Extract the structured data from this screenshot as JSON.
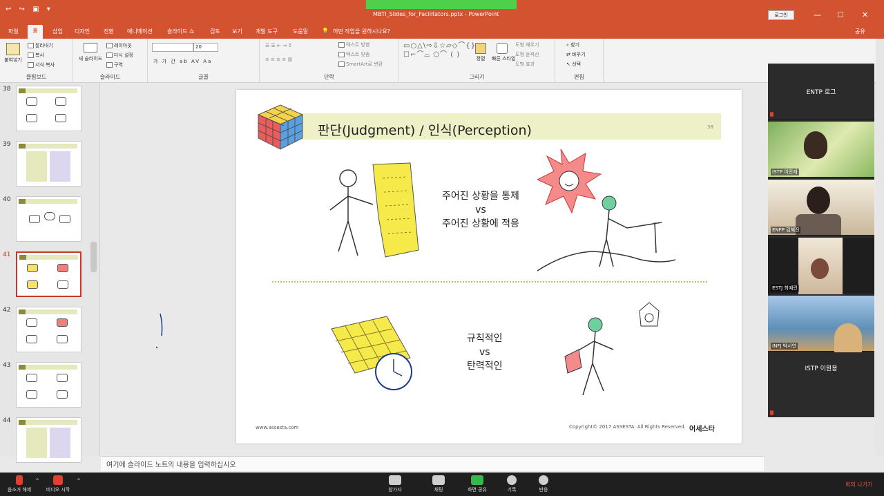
{
  "window": {
    "document_title": "MBTI_Slides_for_Facilitators.pptx - PowerPoint",
    "user_box": "로그인",
    "share": "공유",
    "controls": [
      "—",
      "☐",
      "✕"
    ],
    "quick_access": "↩ ↪ ▣ ▾"
  },
  "menu": {
    "items": [
      "파일",
      "홈",
      "삽입",
      "디자인",
      "전환",
      "애니메이션",
      "슬라이드 쇼",
      "검토",
      "보기",
      "개발 도구",
      "도움말",
      "어떤 작업을 원하시나요?"
    ],
    "active_index": 1
  },
  "ribbon": {
    "clipboard": {
      "label": "클립보드",
      "paste": "붙여넣기",
      "cut": "잘라내기",
      "copy": "복사",
      "format_painter": "서식 복사"
    },
    "slides": {
      "label": "슬라이드",
      "new_slide": "새 슬라이드",
      "layout": "레이아웃",
      "reset": "다시 설정",
      "section": "구역"
    },
    "font": {
      "label": "글꼴",
      "font_name": "",
      "font_size": "20",
      "styles": "가 가 간 ab AV Aa"
    },
    "paragraph": {
      "label": "단락",
      "text_direction": "텍스트 방향",
      "align_text": "텍스트 맞춤",
      "smartart": "SmartArt로 변환"
    },
    "drawing": {
      "label": "그리기",
      "arrange": "정렬",
      "quick_styles": "빠른 스타일",
      "fill": "도형 채우기",
      "outline": "도형 윤곽선",
      "effects": "도형 효과"
    },
    "editing": {
      "label": "편집",
      "find": "찾기",
      "replace": "바꾸기",
      "select": "선택"
    }
  },
  "slides_panel": {
    "numbers": [
      "38",
      "39",
      "40",
      "41",
      "42",
      "43",
      "44"
    ],
    "selected": "41"
  },
  "slide": {
    "title": "판단(Judgment) / 인식(Perception)",
    "page_number": "38",
    "top_caption": [
      "주어진 상황을 통제",
      "vs",
      "주어진 상황에 적응"
    ],
    "bottom_caption": [
      "규칙적인",
      "vs",
      "탄력적인"
    ],
    "footer_left": "www.assesta.com",
    "footer_right": "Copyright© 2017 ASSESTA. All Rights Reserved.",
    "footer_brand": "어세스타"
  },
  "notes": {
    "placeholder": "여기에 슬라이드 노트의 내용을 입력하십시오"
  },
  "gallery": {
    "tiles": [
      {
        "name": "ENTP 로그",
        "type": "name"
      },
      {
        "name": "ISTP 이민재",
        "type": "video"
      },
      {
        "name": "ENFP 김혜진",
        "type": "video"
      },
      {
        "name": "ESTJ 최예린",
        "type": "video"
      },
      {
        "name": "INFJ 박서연",
        "type": "video"
      },
      {
        "name": "ISTP 이원용",
        "type": "name"
      }
    ]
  },
  "zoom_bar": {
    "mute": "음소거 해제",
    "video": "비디오 시작",
    "participants": "참가자",
    "chat": "채팅",
    "share": "화면 공유",
    "record": "기록",
    "reactions": "반응",
    "leave": "회의 나가기"
  },
  "colors": {
    "powerpoint_accent": "#d35230",
    "slide_title_band": "#eef0c8",
    "zoom_leave": "#e25a45"
  }
}
